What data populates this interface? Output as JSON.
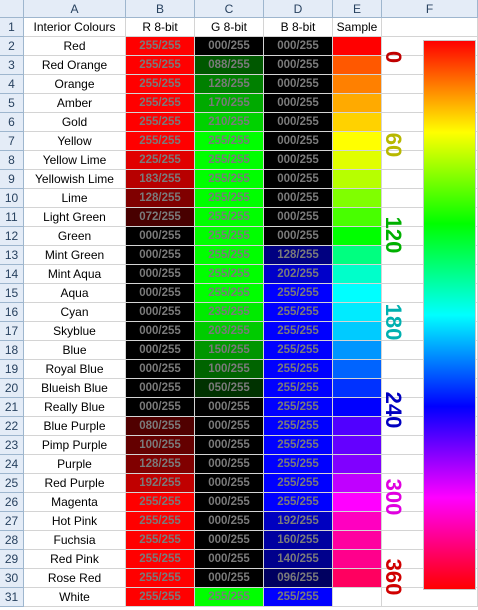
{
  "columns": [
    "A",
    "B",
    "C",
    "D",
    "E",
    "F"
  ],
  "header_row": {
    "a": "Interior Colours",
    "b": "R 8-bit",
    "c": "G 8-bit",
    "d": "B 8-bit",
    "e": "Sample"
  },
  "rows": [
    {
      "num": "2",
      "name": "Red",
      "r": "255/255",
      "g": "000/255",
      "b": "000/255"
    },
    {
      "num": "3",
      "name": "Red Orange",
      "r": "255/255",
      "g": "088/255",
      "b": "000/255"
    },
    {
      "num": "4",
      "name": "Orange",
      "r": "255/255",
      "g": "128/255",
      "b": "000/255"
    },
    {
      "num": "5",
      "name": "Amber",
      "r": "255/255",
      "g": "170/255",
      "b": "000/255"
    },
    {
      "num": "6",
      "name": "Gold",
      "r": "255/255",
      "g": "210/255",
      "b": "000/255"
    },
    {
      "num": "7",
      "name": "Yellow",
      "r": "255/255",
      "g": "255/255",
      "b": "000/255"
    },
    {
      "num": "8",
      "name": "Yellow Lime",
      "r": "225/255",
      "g": "255/255",
      "b": "000/255"
    },
    {
      "num": "9",
      "name": "Yellowish Lime",
      "r": "183/255",
      "g": "255/255",
      "b": "000/255"
    },
    {
      "num": "10",
      "name": "Lime",
      "r": "128/255",
      "g": "255/255",
      "b": "000/255"
    },
    {
      "num": "11",
      "name": "Light Green",
      "r": "072/255",
      "g": "255/255",
      "b": "000/255"
    },
    {
      "num": "12",
      "name": "Green",
      "r": "000/255",
      "g": "255/255",
      "b": "000/255"
    },
    {
      "num": "13",
      "name": "Mint Green",
      "r": "000/255",
      "g": "255/255",
      "b": "128/255"
    },
    {
      "num": "14",
      "name": "Mint Aqua",
      "r": "000/255",
      "g": "255/255",
      "b": "202/255"
    },
    {
      "num": "15",
      "name": "Aqua",
      "r": "000/255",
      "g": "255/255",
      "b": "255/255"
    },
    {
      "num": "16",
      "name": "Cyan",
      "r": "000/255",
      "g": "235/255",
      "b": "255/255"
    },
    {
      "num": "17",
      "name": "Skyblue",
      "r": "000/255",
      "g": "203/255",
      "b": "255/255"
    },
    {
      "num": "18",
      "name": "Blue",
      "r": "000/255",
      "g": "150/255",
      "b": "255/255"
    },
    {
      "num": "19",
      "name": "Royal Blue",
      "r": "000/255",
      "g": "100/255",
      "b": "255/255"
    },
    {
      "num": "20",
      "name": "Blueish Blue",
      "r": "000/255",
      "g": "050/255",
      "b": "255/255"
    },
    {
      "num": "21",
      "name": "Really Blue",
      "r": "000/255",
      "g": "000/255",
      "b": "255/255"
    },
    {
      "num": "22",
      "name": "Blue Purple",
      "r": "080/255",
      "g": "000/255",
      "b": "255/255"
    },
    {
      "num": "23",
      "name": "Pimp Purple",
      "r": "100/255",
      "g": "000/255",
      "b": "255/255"
    },
    {
      "num": "24",
      "name": "Purple",
      "r": "128/255",
      "g": "000/255",
      "b": "255/255"
    },
    {
      "num": "25",
      "name": "Red Purple",
      "r": "192/255",
      "g": "000/255",
      "b": "255/255"
    },
    {
      "num": "26",
      "name": "Magenta",
      "r": "255/255",
      "g": "000/255",
      "b": "255/255"
    },
    {
      "num": "27",
      "name": "Hot Pink",
      "r": "255/255",
      "g": "000/255",
      "b": "192/255"
    },
    {
      "num": "28",
      "name": "Fuchsia",
      "r": "255/255",
      "g": "000/255",
      "b": "160/255"
    },
    {
      "num": "29",
      "name": "Red Pink",
      "r": "255/255",
      "g": "000/255",
      "b": "140/255"
    },
    {
      "num": "30",
      "name": "Rose Red",
      "r": "255/255",
      "g": "000/255",
      "b": "096/255"
    },
    {
      "num": "31",
      "name": "White",
      "r": "255/255",
      "g": "255/255",
      "b": "255/255"
    }
  ],
  "hue_labels": [
    {
      "text": "0",
      "color": "#c00000"
    },
    {
      "text": "60",
      "color": "#b8b800"
    },
    {
      "text": "120",
      "color": "#00b000"
    },
    {
      "text": "180",
      "color": "#00b0b0"
    },
    {
      "text": "240",
      "color": "#0000c0"
    },
    {
      "text": "300",
      "color": "#e000e0"
    },
    {
      "text": "360",
      "color": "#d00000"
    }
  ]
}
